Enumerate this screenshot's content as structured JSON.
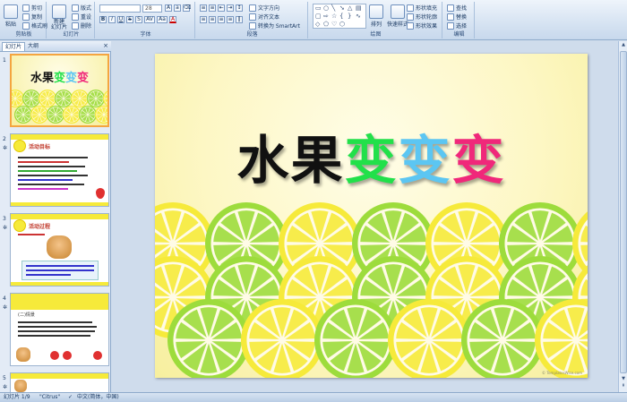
{
  "ribbon": {
    "clipboard": {
      "paste": "粘贴",
      "cut": "剪切",
      "copy": "复制",
      "format_painter": "格式刷",
      "label": "剪贴板"
    },
    "slides": {
      "new_slide": "新建\n幻灯片",
      "layout": "版式",
      "reset": "重设",
      "delete": "删除",
      "label": "幻灯片"
    },
    "font": {
      "font_name": "",
      "font_size": "28",
      "bold": "B",
      "italic": "I",
      "underline": "U",
      "strike": "S",
      "shadow": "S",
      "char_spacing": "AV",
      "case": "Aa",
      "color": "A",
      "label": "字体"
    },
    "paragraph": {
      "text_direction": "文字方向",
      "align_text": "对齐文本",
      "smartart": "转换为 SmartArt",
      "label": "段落"
    },
    "drawing": {
      "arrange": "排列",
      "quick_styles": "快速样式",
      "shape_fill": "形状填充",
      "shape_outline": "形状轮廓",
      "shape_effects": "形状效果",
      "label": "绘图"
    },
    "editing": {
      "find": "查找",
      "replace": "替换",
      "select": "选择",
      "label": "编辑"
    }
  },
  "leftpane": {
    "tab_slides": "幻灯片",
    "tab_outline": "大纲",
    "close": "×",
    "thumbs": [
      {
        "num": "1",
        "title": "水果变变变"
      },
      {
        "num": "2",
        "title": "活动目标"
      },
      {
        "num": "3",
        "title": "活动过程"
      },
      {
        "num": "4",
        "title": "(二)情景"
      },
      {
        "num": "5",
        "title": ""
      }
    ]
  },
  "slide": {
    "title_part1": "水果",
    "title_part2": "变",
    "title_part3": "变",
    "title_part4": "变",
    "watermark": "© TemplatesWise.com"
  },
  "colors": {
    "title_black": "#111111",
    "title_green": "#22e04a",
    "title_blue": "#5cc6f2",
    "title_pink": "#f0287a",
    "lemon": "#f6ea3a",
    "lime": "#9ddc3c",
    "accent_orange": "#f4a540"
  },
  "statusbar": {
    "slide_info": "幻灯片 1/9",
    "theme": "\"Citrus\"",
    "language": "中文(简体，中国)"
  }
}
